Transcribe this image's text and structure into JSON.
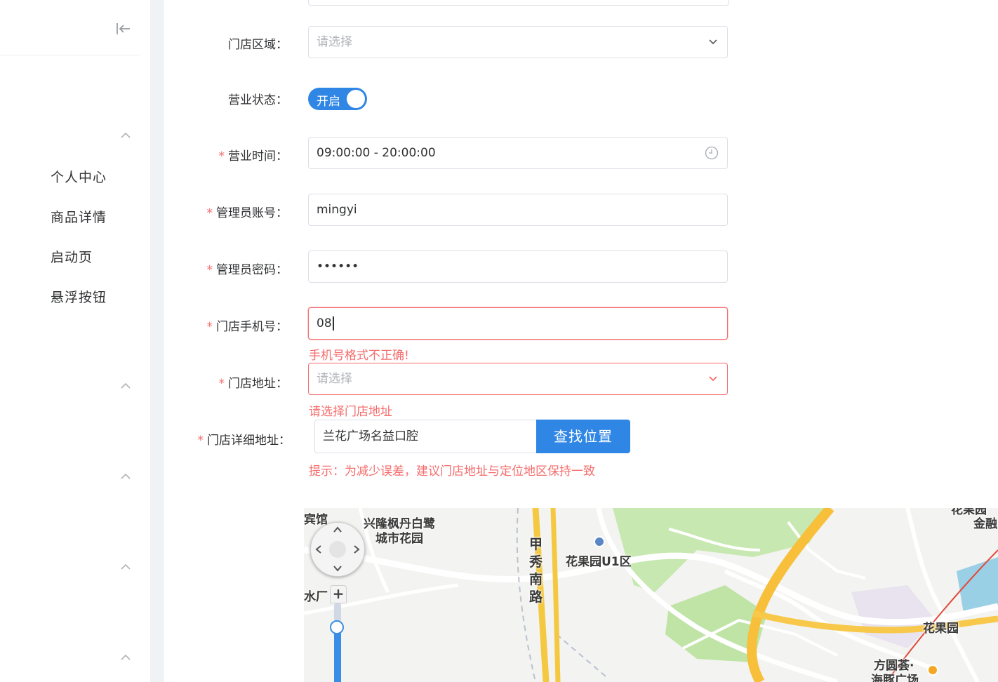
{
  "sidebar": {
    "menu_items": [
      "个人中心",
      "商品详情",
      "启动页",
      "悬浮按钮"
    ]
  },
  "form": {
    "store_area": {
      "label": "门店区域：",
      "placeholder": "请选择"
    },
    "business_status": {
      "label": "营业状态：",
      "toggle_text": "开启",
      "on": true
    },
    "business_hours": {
      "label": "营业时间：",
      "value": "09:00:00 - 20:00:00"
    },
    "admin_account": {
      "label": "管理员账号：",
      "value": "mingyi"
    },
    "admin_password": {
      "label": "管理员密码：",
      "value": "••••••"
    },
    "store_phone": {
      "label": "门店手机号：",
      "value": "08",
      "error": "手机号格式不正确!"
    },
    "store_address": {
      "label": "门店地址：",
      "placeholder": "请选择",
      "error": "请选择门店地址"
    },
    "store_detail_address": {
      "label": "门店详细地址：",
      "value": "兰花广场名益口腔",
      "button": "查找位置",
      "tip": "提示：为减少误差，建议门店地址与定位地区保持一致"
    }
  },
  "required_mark": "*",
  "map": {
    "labels": {
      "hotel": "宾馆",
      "xinglong": [
        "兴隆枫丹白鹭",
        "城市花园"
      ],
      "jiaxiu_road": "甲秀南路",
      "huaguoyuan_u1": "花果园U1区",
      "shuichang": "水厂",
      "huaguoyuan": "花果园",
      "finance": "金融",
      "fangyuan": [
        "方圆荟·",
        "海豚广场"
      ],
      "top_right": "花果园"
    },
    "zoom_plus": "+",
    "zoom_level_fraction": 0.55
  },
  "colors": {
    "primary": "#2f86e4",
    "error": "#f56c6c"
  }
}
